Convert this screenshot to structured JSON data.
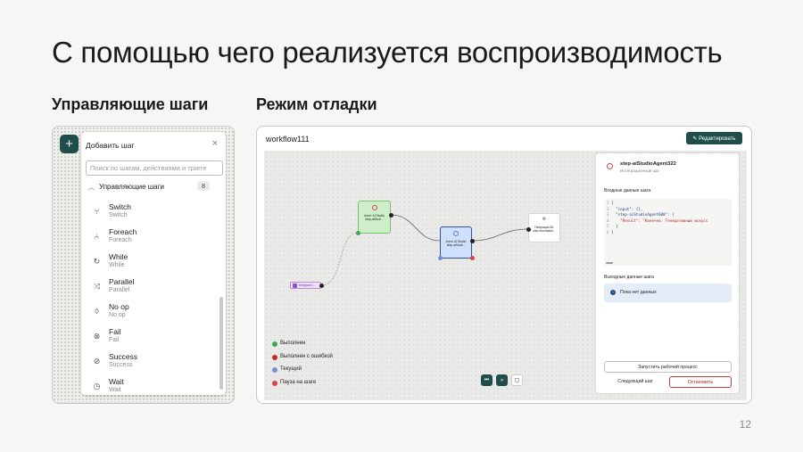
{
  "slide": {
    "title": "С помощью чего реализуется воспроизводимость",
    "left_subtitle": "Управляющие шаги",
    "right_subtitle": "Режим отладки",
    "page_number": "12"
  },
  "steps_panel": {
    "header": "Добавить шаг",
    "close_glyph": "×",
    "add_glyph": "+",
    "search_placeholder": "Поиск по шагам, действиями и тригге",
    "group": {
      "label": "Управляющие шаги",
      "count": "8"
    },
    "items": [
      {
        "name": "Switch",
        "desc": "Switch",
        "icon": "switch-icon",
        "glyph": "⑂"
      },
      {
        "name": "Foreach",
        "desc": "Foreach",
        "icon": "foreach-icon",
        "glyph": "⑃"
      },
      {
        "name": "While",
        "desc": "While",
        "icon": "while-icon",
        "glyph": "↻"
      },
      {
        "name": "Parallel",
        "desc": "Parallel",
        "icon": "parallel-icon",
        "glyph": "⤨"
      },
      {
        "name": "No op",
        "desc": "No op",
        "icon": "no-op-icon",
        "glyph": "◊"
      },
      {
        "name": "Fail",
        "desc": "Fail",
        "icon": "fail-icon",
        "glyph": "⊗"
      },
      {
        "name": "Success",
        "desc": "Success",
        "icon": "success-icon",
        "glyph": "⊘"
      },
      {
        "name": "Wait",
        "desc": "Wait",
        "icon": "wait-icon",
        "glyph": "◷"
      }
    ]
  },
  "debug_panel": {
    "workflow_title": "workflow111",
    "edit_button": "✎ Редактировать",
    "nodes": {
      "green": {
        "title": "Агент AI Studio",
        "sub": "step-aiStudi..."
      },
      "blue": {
        "title": "Агент AI Studio",
        "sub": "step-aiStudi..."
      },
      "white": {
        "title": "Генерация ML",
        "sub": "step-foundation..."
      },
      "trigger": {
        "title": "telegram-l..."
      }
    },
    "legend": [
      {
        "label": "Выполнен",
        "color": "#3ea84a"
      },
      {
        "label": "Выполнен с ошибкой",
        "color": "#c62b2b"
      },
      {
        "label": "Текущий",
        "color": "#6f8fe0"
      },
      {
        "label": "Пауза на шаге",
        "color": "#d94343"
      }
    ],
    "controls": {
      "step_glyph": "⏭",
      "run_glyph": "»",
      "stop_glyph": "▢"
    },
    "side": {
      "step_name": "step-aiStudioAgent322",
      "step_type": "Интеграционный шаг",
      "input_label": "Входные данные шага",
      "code_lines": [
        {
          "n": "1",
          "t": "{"
        },
        {
          "n": "2",
          "t": "  \"input\": {},"
        },
        {
          "n": "3",
          "t": "  \"step-aiStudioAgent600\": {"
        },
        {
          "n": "4",
          "t": "    \"Result\": \"Конечно. Генеративный искусс"
        },
        {
          "n": "5",
          "t": "  }"
        },
        {
          "n": "6",
          "t": "}"
        }
      ],
      "output_label": "Выходные данные шага",
      "no_data": "Пока нет данных",
      "run_button": "Запустить рабочий процесс",
      "next_button": "Следующий шаг",
      "stop_button": "Остановить"
    }
  },
  "colors": {
    "accent": "#1f4e4a",
    "danger": "#c94141",
    "info": "#e3ecf8"
  }
}
